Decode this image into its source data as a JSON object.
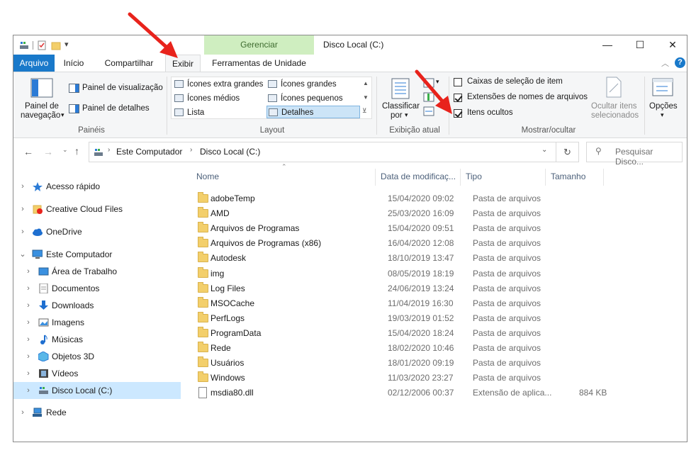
{
  "window": {
    "title": "Disco Local (C:)",
    "minimize": "—",
    "maximize": "☐",
    "close": "✕"
  },
  "ribbon_tabs": {
    "file": "Arquivo",
    "home": "Início",
    "share": "Compartilhar",
    "view": "Exibir",
    "drive_tools": "Ferramentas de Unidade",
    "manage": "Gerenciar"
  },
  "ribbon": {
    "panes": {
      "nav_pane_line1": "Painel de",
      "nav_pane_line2": "navegação",
      "preview_pane": "Painel de visualização",
      "details_pane": "Painel de detalhes",
      "label": "Painéis"
    },
    "layout": {
      "items": [
        "Ícones extra grandes",
        "Ícones grandes",
        "Ícones médios",
        "Ícones pequenos",
        "Lista",
        "Detalhes"
      ],
      "selected": "Detalhes",
      "label": "Layout"
    },
    "current_view": {
      "sort_line1": "Classificar",
      "sort_line2": "por",
      "label": "Exibição atual"
    },
    "show_hide": {
      "item_checkboxes": "Caixas de seleção de item",
      "item_checkboxes_checked": false,
      "file_extensions": "Extensões de nomes de arquivos",
      "file_extensions_checked": true,
      "hidden_items": "Itens ocultos",
      "hidden_items_checked": true,
      "hide_selected_line1": "Ocultar itens",
      "hide_selected_line2": "selecionados",
      "label": "Mostrar/ocultar"
    },
    "options": "Opções"
  },
  "address": {
    "segments": [
      "Este Computador",
      "Disco Local (C:)"
    ],
    "search_placeholder": "Pesquisar Disco..."
  },
  "nav": {
    "items": [
      {
        "label": "Acesso rápido",
        "icon": "star-icon"
      },
      {
        "label": "Creative Cloud Files",
        "icon": "creative-cloud-icon"
      },
      {
        "label": "OneDrive",
        "icon": "cloud-icon"
      },
      {
        "label": "Este Computador",
        "icon": "computer-icon"
      },
      {
        "label": "Área de Trabalho",
        "icon": "desktop-icon"
      },
      {
        "label": "Documentos",
        "icon": "documents-icon"
      },
      {
        "label": "Downloads",
        "icon": "download-icon"
      },
      {
        "label": "Imagens",
        "icon": "pictures-icon"
      },
      {
        "label": "Músicas",
        "icon": "music-icon"
      },
      {
        "label": "Objetos 3D",
        "icon": "3d-objects-icon"
      },
      {
        "label": "Vídeos",
        "icon": "videos-icon"
      },
      {
        "label": "Disco Local (C:)",
        "icon": "drive-icon"
      },
      {
        "label": "Rede",
        "icon": "network-icon"
      }
    ]
  },
  "columns": {
    "name": "Nome",
    "date": "Data de modificaç...",
    "type": "Tipo",
    "size": "Tamanho"
  },
  "files": [
    {
      "name": "adobeTemp",
      "date": "15/04/2020 09:02",
      "type": "Pasta de arquivos",
      "size": ""
    },
    {
      "name": "AMD",
      "date": "25/03/2020 16:09",
      "type": "Pasta de arquivos",
      "size": ""
    },
    {
      "name": "Arquivos de Programas",
      "date": "15/04/2020 09:51",
      "type": "Pasta de arquivos",
      "size": ""
    },
    {
      "name": "Arquivos de Programas (x86)",
      "date": "16/04/2020 12:08",
      "type": "Pasta de arquivos",
      "size": ""
    },
    {
      "name": "Autodesk",
      "date": "18/10/2019 13:47",
      "type": "Pasta de arquivos",
      "size": ""
    },
    {
      "name": "img",
      "date": "08/05/2019 18:19",
      "type": "Pasta de arquivos",
      "size": ""
    },
    {
      "name": "Log Files",
      "date": "24/06/2019 13:24",
      "type": "Pasta de arquivos",
      "size": ""
    },
    {
      "name": "MSOCache",
      "date": "11/04/2019 16:30",
      "type": "Pasta de arquivos",
      "size": ""
    },
    {
      "name": "PerfLogs",
      "date": "19/03/2019 01:52",
      "type": "Pasta de arquivos",
      "size": ""
    },
    {
      "name": "ProgramData",
      "date": "15/04/2020 18:24",
      "type": "Pasta de arquivos",
      "size": ""
    },
    {
      "name": "Rede",
      "date": "18/02/2020 10:46",
      "type": "Pasta de arquivos",
      "size": ""
    },
    {
      "name": "Usuários",
      "date": "18/01/2020 09:19",
      "type": "Pasta de arquivos",
      "size": ""
    },
    {
      "name": "Windows",
      "date": "11/03/2020 23:27",
      "type": "Pasta de arquivos",
      "size": ""
    },
    {
      "name": "msdia80.dll",
      "date": "02/12/2006 00:37",
      "type": "Extensão de aplica...",
      "size": "884 KB"
    }
  ],
  "colors": {
    "accent": "#1979ca",
    "selection": "#cce8ff",
    "manage_band": "#cfeec0",
    "annotation_arrow": "#e8231c"
  }
}
